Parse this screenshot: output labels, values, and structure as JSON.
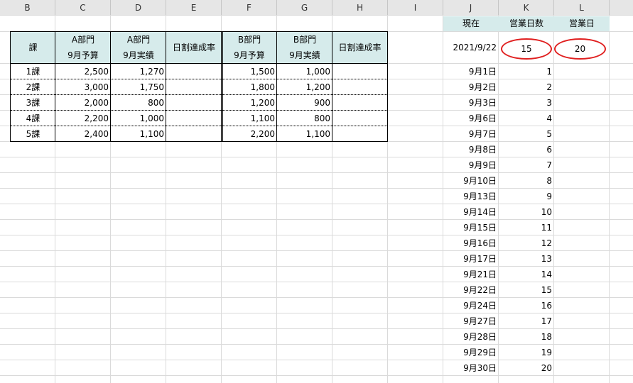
{
  "column_headers": [
    "B",
    "C",
    "D",
    "E",
    "F",
    "G",
    "H",
    "I",
    "J",
    "K",
    "L"
  ],
  "table": {
    "header": {
      "ka": "課",
      "a_budget": [
        "A部門",
        "9月予算"
      ],
      "a_actual": [
        "A部門",
        "9月実績"
      ],
      "a_rate": "日割達成率",
      "b_budget": [
        "B部門",
        "9月予算"
      ],
      "b_actual": [
        "B部門",
        "9月実績"
      ],
      "b_rate": "日割達成率"
    },
    "rows": [
      {
        "ka": "1課",
        "a_budget": "2,500",
        "a_actual": "1,270",
        "b_budget": "1,500",
        "b_actual": "1,000"
      },
      {
        "ka": "2課",
        "a_budget": "3,000",
        "a_actual": "1,750",
        "b_budget": "1,800",
        "b_actual": "1,200"
      },
      {
        "ka": "3課",
        "a_budget": "2,000",
        "a_actual": "800",
        "b_budget": "1,200",
        "b_actual": "900"
      },
      {
        "ka": "4課",
        "a_budget": "2,200",
        "a_actual": "1,000",
        "b_budget": "1,100",
        "b_actual": "800"
      },
      {
        "ka": "5課",
        "a_budget": "2,400",
        "a_actual": "1,100",
        "b_budget": "2,200",
        "b_actual": "1,100"
      }
    ]
  },
  "calendar": {
    "hdr_now": "現在",
    "hdr_days": "営業日数",
    "hdr_bizday": "営業日",
    "current_date": "2021/9/22",
    "days_count": "15",
    "biz_days": "20",
    "dates": [
      {
        "date": "9月1日",
        "n": "1"
      },
      {
        "date": "9月2日",
        "n": "2"
      },
      {
        "date": "9月3日",
        "n": "3"
      },
      {
        "date": "9月6日",
        "n": "4"
      },
      {
        "date": "9月7日",
        "n": "5"
      },
      {
        "date": "9月8日",
        "n": "6"
      },
      {
        "date": "9月9日",
        "n": "7"
      },
      {
        "date": "9月10日",
        "n": "8"
      },
      {
        "date": "9月13日",
        "n": "9"
      },
      {
        "date": "9月14日",
        "n": "10"
      },
      {
        "date": "9月15日",
        "n": "11"
      },
      {
        "date": "9月16日",
        "n": "12"
      },
      {
        "date": "9月17日",
        "n": "13"
      },
      {
        "date": "9月21日",
        "n": "14"
      },
      {
        "date": "9月22日",
        "n": "15"
      },
      {
        "date": "9月24日",
        "n": "16"
      },
      {
        "date": "9月27日",
        "n": "17"
      },
      {
        "date": "9月28日",
        "n": "18"
      },
      {
        "date": "9月29日",
        "n": "19"
      },
      {
        "date": "9月30日",
        "n": "20"
      }
    ]
  },
  "colors": {
    "header_fill": "#d6ebeb",
    "highlight_oval": "#e02020"
  }
}
